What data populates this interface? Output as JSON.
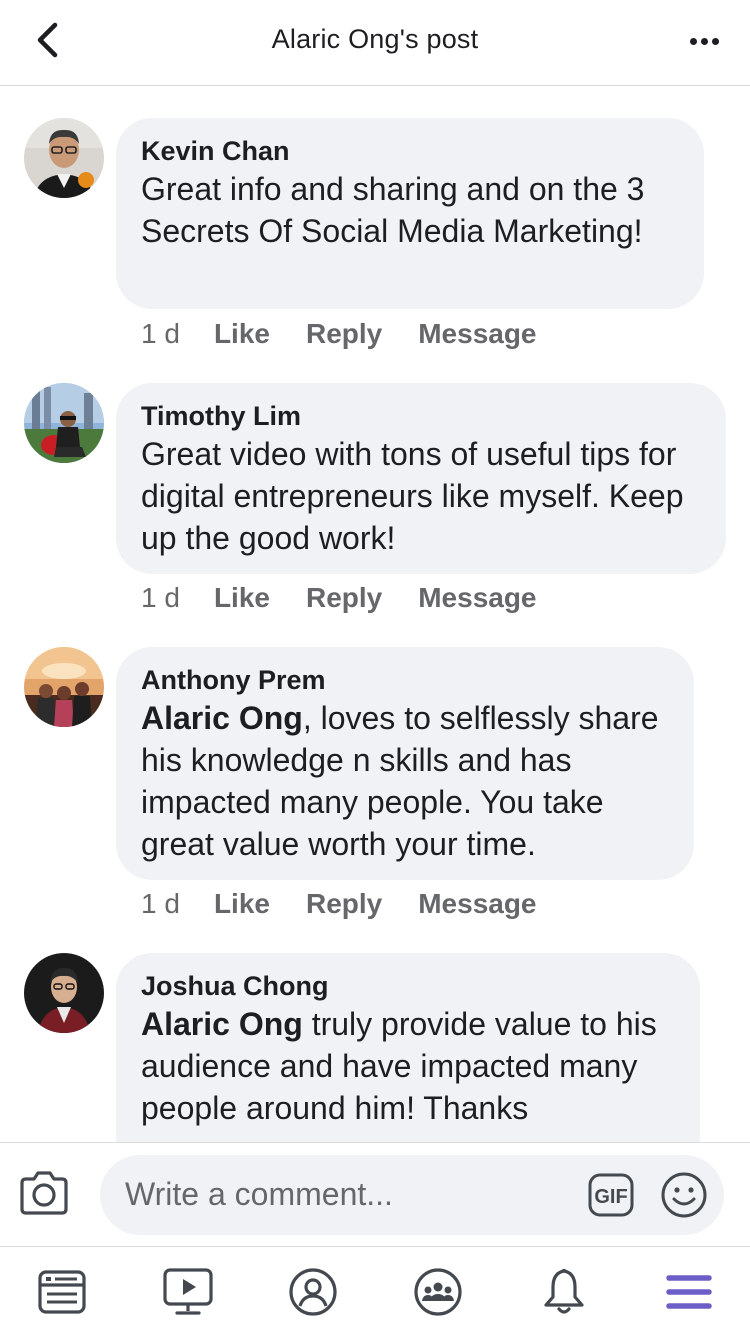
{
  "header": {
    "title": "Alaric Ong's post"
  },
  "comments": [
    {
      "author": "Kevin Chan",
      "mention": "",
      "text": "Great info and sharing and on the 3  Secrets Of Social Media Marketing!",
      "time": "1 d"
    },
    {
      "author": "Timothy Lim",
      "mention": "",
      "text": "Great video with tons of useful tips for digital entrepreneurs like myself. Keep up the good work!",
      "time": "1 d"
    },
    {
      "author": "Anthony Prem",
      "mention": "Alaric Ong",
      "text": ", loves to selflessly share his knowledge n skills and has impacted many people. You take great value worth your time.",
      "time": "1 d"
    },
    {
      "author": "Joshua Chong",
      "mention": "Alaric Ong",
      "text": " truly provide value to his audience and have impacted many people around him! Thanks",
      "time": ""
    }
  ],
  "actions": {
    "like": "Like",
    "reply": "Reply",
    "message": "Message"
  },
  "composer": {
    "placeholder": "Write a comment...",
    "gif_label": "GIF"
  },
  "colors": {
    "accent": "#6b5fc7",
    "bubble": "#f0f2f5",
    "muted": "#65676b"
  },
  "nav": [
    {
      "icon": "news-feed-icon"
    },
    {
      "icon": "watch-icon"
    },
    {
      "icon": "profile-icon"
    },
    {
      "icon": "groups-icon"
    },
    {
      "icon": "notifications-icon"
    },
    {
      "icon": "menu-icon",
      "active": true
    }
  ]
}
